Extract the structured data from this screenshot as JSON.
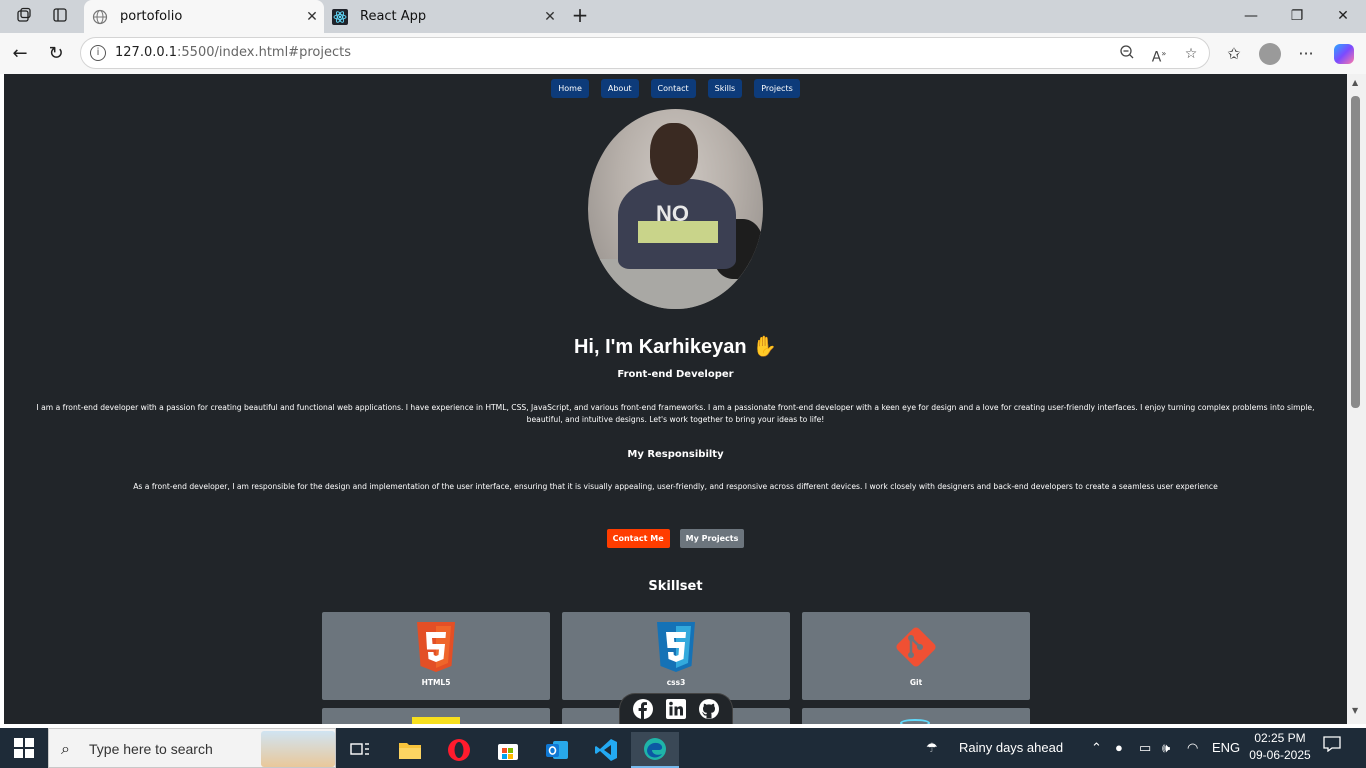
{
  "browser": {
    "tabs": [
      {
        "title": "portofolio",
        "active": true
      },
      {
        "title": "React App",
        "active": false
      }
    ],
    "url_host": "127.0.0.1",
    "url_path": ":5500/index.html#projects"
  },
  "page": {
    "nav": [
      "Home",
      "About",
      "Contact",
      "Skills",
      "Projects"
    ],
    "hero_title": "Hi, I'm Karhikeyan",
    "hero_emoji": "✋",
    "hero_subtitle": "Front-end Developer",
    "hero_description": "I am a front-end developer with a passion for creating beautiful and functional web applications. I have experience in HTML, CSS, JavaScript, and various front-end frameworks. I am a passionate front-end developer with a keen eye for design and a love for creating user-friendly interfaces. I enjoy turning complex problems into simple, beautiful, and intuitive designs. Let's work together to bring your ideas to life!",
    "responsibility_title": "My Responsibilty",
    "responsibility_text": "As a front-end developer, I am responsible for the design and implementation of the user interface, ensuring that it is visually appealing, user-friendly, and responsive across different devices. I work closely with designers and back-end developers to create a seamless user experience",
    "contact_button": "Contact Me",
    "projects_button": "My Projects",
    "skillset_title": "Skillset",
    "skills": [
      "HTML5",
      "css3",
      "Git"
    ],
    "colors": {
      "background": "#212529",
      "nav": "#0d3b7a",
      "contact": "#ff3d00",
      "card": "#6c757d"
    }
  },
  "taskbar": {
    "search_placeholder": "Type here to search",
    "weather": "Rainy days ahead",
    "language": "ENG",
    "time": "02:25 PM",
    "date": "09-06-2025"
  }
}
